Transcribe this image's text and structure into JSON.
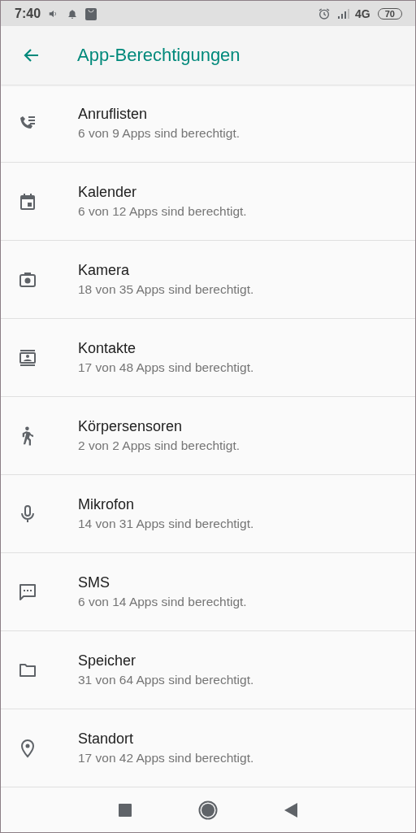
{
  "status_bar": {
    "time": "7:40",
    "network": "4G",
    "battery": "70"
  },
  "app_bar": {
    "title": "App-Berechtigungen"
  },
  "permissions": [
    {
      "name": "Anruflisten",
      "summary": "6 von 9 Apps sind berechtigt."
    },
    {
      "name": "Kalender",
      "summary": "6 von 12 Apps sind berechtigt."
    },
    {
      "name": "Kamera",
      "summary": "18 von 35 Apps sind berechtigt."
    },
    {
      "name": "Kontakte",
      "summary": "17 von 48 Apps sind berechtigt."
    },
    {
      "name": "Körpersensoren",
      "summary": "2 von 2 Apps sind berechtigt."
    },
    {
      "name": "Mikrofon",
      "summary": "14 von 31 Apps sind berechtigt."
    },
    {
      "name": "SMS",
      "summary": "6 von 14 Apps sind berechtigt."
    },
    {
      "name": "Speicher",
      "summary": "31 von 64 Apps sind berechtigt."
    },
    {
      "name": "Standort",
      "summary": "17 von 42 Apps sind berechtigt."
    }
  ]
}
